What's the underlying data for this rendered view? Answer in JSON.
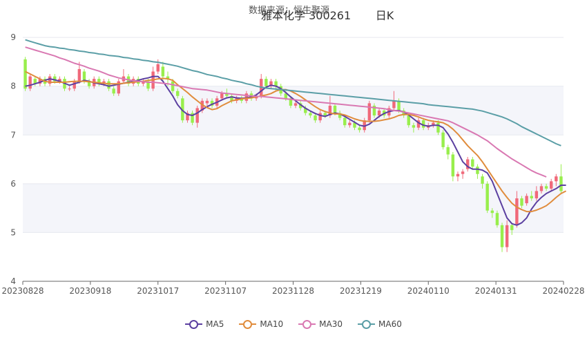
{
  "watermark": "数据来源：恒生聚源",
  "title": "雅本化学 300261       日K",
  "chart_data": {
    "type": "candlestick",
    "x_ticks": [
      "20230828",
      "20230918",
      "20231017",
      "20231107",
      "20231128",
      "20231219",
      "20240110",
      "20240131",
      "20240228"
    ],
    "y_ticks": [
      4,
      5,
      6,
      7,
      8,
      9
    ],
    "ylim": [
      4,
      9.2
    ],
    "colors": {
      "up": "#f0697a",
      "down": "#98ee4c"
    },
    "candles": [
      {
        "o": 8.55,
        "c": 7.95,
        "h": 8.6,
        "l": 7.9
      },
      {
        "o": 7.95,
        "c": 8.2,
        "h": 8.25,
        "l": 7.9
      },
      {
        "o": 8.15,
        "c": 8.05,
        "h": 8.2,
        "l": 8.0
      },
      {
        "o": 8.05,
        "c": 8.15,
        "h": 8.2,
        "l": 8.0
      },
      {
        "o": 8.15,
        "c": 8.05,
        "h": 8.2,
        "l": 8.0
      },
      {
        "o": 8.05,
        "c": 8.2,
        "h": 8.25,
        "l": 8.0
      },
      {
        "o": 8.2,
        "c": 8.1,
        "h": 8.25,
        "l": 8.05
      },
      {
        "o": 8.1,
        "c": 8.15,
        "h": 8.2,
        "l": 8.05
      },
      {
        "o": 8.15,
        "c": 7.95,
        "h": 8.2,
        "l": 7.9
      },
      {
        "o": 7.95,
        "c": 7.95,
        "h": 8.0,
        "l": 7.9
      },
      {
        "o": 7.95,
        "c": 8.1,
        "h": 8.15,
        "l": 7.9
      },
      {
        "o": 8.1,
        "c": 8.35,
        "h": 8.5,
        "l": 8.05
      },
      {
        "o": 8.3,
        "c": 8.1,
        "h": 8.35,
        "l": 8.05
      },
      {
        "o": 8.1,
        "c": 8.0,
        "h": 8.15,
        "l": 7.95
      },
      {
        "o": 8.0,
        "c": 8.15,
        "h": 8.2,
        "l": 7.95
      },
      {
        "o": 8.15,
        "c": 8.05,
        "h": 8.2,
        "l": 8.0
      },
      {
        "o": 8.05,
        "c": 8.1,
        "h": 8.15,
        "l": 8.0
      },
      {
        "o": 8.1,
        "c": 7.95,
        "h": 8.15,
        "l": 7.9
      },
      {
        "o": 7.95,
        "c": 7.85,
        "h": 8.0,
        "l": 7.8
      },
      {
        "o": 7.85,
        "c": 8.1,
        "h": 8.15,
        "l": 7.8
      },
      {
        "o": 8.1,
        "c": 8.2,
        "h": 8.35,
        "l": 8.05
      },
      {
        "o": 8.2,
        "c": 8.05,
        "h": 8.25,
        "l": 8.0
      },
      {
        "o": 8.05,
        "c": 8.15,
        "h": 8.2,
        "l": 8.0
      },
      {
        "o": 8.15,
        "c": 8.05,
        "h": 8.2,
        "l": 8.0
      },
      {
        "o": 8.05,
        "c": 8.1,
        "h": 8.15,
        "l": 8.0
      },
      {
        "o": 8.1,
        "c": 7.95,
        "h": 8.15,
        "l": 7.9
      },
      {
        "o": 7.95,
        "c": 8.3,
        "h": 8.4,
        "l": 7.9
      },
      {
        "o": 8.3,
        "c": 8.45,
        "h": 8.55,
        "l": 8.25
      },
      {
        "o": 8.4,
        "c": 8.2,
        "h": 8.5,
        "l": 8.1
      },
      {
        "o": 8.2,
        "c": 8.15,
        "h": 8.3,
        "l": 8.0
      },
      {
        "o": 8.1,
        "c": 7.9,
        "h": 8.15,
        "l": 7.85
      },
      {
        "o": 7.9,
        "c": 7.8,
        "h": 7.95,
        "l": 7.75
      },
      {
        "o": 7.75,
        "c": 7.3,
        "h": 7.8,
        "l": 7.25
      },
      {
        "o": 7.3,
        "c": 7.45,
        "h": 7.5,
        "l": 7.25
      },
      {
        "o": 7.45,
        "c": 7.25,
        "h": 7.5,
        "l": 7.2
      },
      {
        "o": 7.25,
        "c": 7.55,
        "h": 7.6,
        "l": 7.15
      },
      {
        "o": 7.5,
        "c": 7.7,
        "h": 7.75,
        "l": 7.45
      },
      {
        "o": 7.65,
        "c": 7.7,
        "h": 7.75,
        "l": 7.6
      },
      {
        "o": 7.7,
        "c": 7.6,
        "h": 7.75,
        "l": 7.55
      },
      {
        "o": 7.6,
        "c": 7.75,
        "h": 7.8,
        "l": 7.55
      },
      {
        "o": 7.75,
        "c": 7.85,
        "h": 7.9,
        "l": 7.7
      },
      {
        "o": 7.85,
        "c": 7.8,
        "h": 7.95,
        "l": 7.75
      },
      {
        "o": 7.8,
        "c": 7.7,
        "h": 7.85,
        "l": 7.65
      },
      {
        "o": 7.7,
        "c": 7.75,
        "h": 7.8,
        "l": 7.65
      },
      {
        "o": 7.75,
        "c": 7.7,
        "h": 7.8,
        "l": 7.65
      },
      {
        "o": 7.7,
        "c": 7.85,
        "h": 7.9,
        "l": 7.65
      },
      {
        "o": 7.85,
        "c": 7.75,
        "h": 7.9,
        "l": 7.7
      },
      {
        "o": 7.75,
        "c": 7.8,
        "h": 7.85,
        "l": 7.7
      },
      {
        "o": 7.8,
        "c": 8.15,
        "h": 8.25,
        "l": 7.75
      },
      {
        "o": 8.15,
        "c": 8.0,
        "h": 8.2,
        "l": 7.95
      },
      {
        "o": 8.0,
        "c": 8.1,
        "h": 8.15,
        "l": 7.95
      },
      {
        "o": 8.1,
        "c": 8.0,
        "h": 8.15,
        "l": 7.9
      },
      {
        "o": 8.0,
        "c": 7.85,
        "h": 8.05,
        "l": 7.8
      },
      {
        "o": 7.85,
        "c": 7.75,
        "h": 7.9,
        "l": 7.7
      },
      {
        "o": 7.75,
        "c": 7.6,
        "h": 7.8,
        "l": 7.55
      },
      {
        "o": 7.6,
        "c": 7.65,
        "h": 7.7,
        "l": 7.55
      },
      {
        "o": 7.65,
        "c": 7.55,
        "h": 7.7,
        "l": 7.5
      },
      {
        "o": 7.55,
        "c": 7.45,
        "h": 7.6,
        "l": 7.4
      },
      {
        "o": 7.45,
        "c": 7.4,
        "h": 7.5,
        "l": 7.35
      },
      {
        "o": 7.4,
        "c": 7.3,
        "h": 7.45,
        "l": 7.25
      },
      {
        "o": 7.3,
        "c": 7.45,
        "h": 7.5,
        "l": 7.25
      },
      {
        "o": 7.45,
        "c": 7.4,
        "h": 7.5,
        "l": 7.35
      },
      {
        "o": 7.4,
        "c": 7.6,
        "h": 7.8,
        "l": 7.35
      },
      {
        "o": 7.6,
        "c": 7.45,
        "h": 7.65,
        "l": 7.4
      },
      {
        "o": 7.45,
        "c": 7.35,
        "h": 7.5,
        "l": 7.3
      },
      {
        "o": 7.35,
        "c": 7.2,
        "h": 7.4,
        "l": 7.15
      },
      {
        "o": 7.2,
        "c": 7.25,
        "h": 7.3,
        "l": 7.15
      },
      {
        "o": 7.25,
        "c": 7.15,
        "h": 7.3,
        "l": 7.1
      },
      {
        "o": 7.15,
        "c": 7.1,
        "h": 7.2,
        "l": 7.05
      },
      {
        "o": 7.1,
        "c": 7.3,
        "h": 7.35,
        "l": 7.05
      },
      {
        "o": 7.3,
        "c": 7.65,
        "h": 7.7,
        "l": 7.25
      },
      {
        "o": 7.6,
        "c": 7.4,
        "h": 7.65,
        "l": 7.35
      },
      {
        "o": 7.4,
        "c": 7.5,
        "h": 7.55,
        "l": 7.35
      },
      {
        "o": 7.5,
        "c": 7.4,
        "h": 7.55,
        "l": 7.35
      },
      {
        "o": 7.4,
        "c": 7.55,
        "h": 7.6,
        "l": 7.35
      },
      {
        "o": 7.55,
        "c": 7.7,
        "h": 7.9,
        "l": 7.5
      },
      {
        "o": 7.7,
        "c": 7.5,
        "h": 7.75,
        "l": 7.45
      },
      {
        "o": 7.5,
        "c": 7.4,
        "h": 7.55,
        "l": 7.35
      },
      {
        "o": 7.4,
        "c": 7.2,
        "h": 7.45,
        "l": 7.15
      },
      {
        "o": 7.2,
        "c": 7.15,
        "h": 7.25,
        "l": 7.05
      },
      {
        "o": 7.15,
        "c": 7.3,
        "h": 7.35,
        "l": 7.1
      },
      {
        "o": 7.3,
        "c": 7.15,
        "h": 7.35,
        "l": 7.1
      },
      {
        "o": 7.15,
        "c": 7.2,
        "h": 7.25,
        "l": 7.1
      },
      {
        "o": 7.2,
        "c": 7.25,
        "h": 7.3,
        "l": 7.15
      },
      {
        "o": 7.25,
        "c": 7.05,
        "h": 7.3,
        "l": 7.0
      },
      {
        "o": 7.05,
        "c": 6.75,
        "h": 7.1,
        "l": 6.7
      },
      {
        "o": 6.75,
        "c": 6.6,
        "h": 6.8,
        "l": 6.5
      },
      {
        "o": 6.6,
        "c": 6.15,
        "h": 6.65,
        "l": 6.05
      },
      {
        "o": 6.15,
        "c": 6.2,
        "h": 6.25,
        "l": 6.05
      },
      {
        "o": 6.2,
        "c": 6.25,
        "h": 6.3,
        "l": 6.1
      },
      {
        "o": 6.3,
        "c": 6.5,
        "h": 6.55,
        "l": 6.25
      },
      {
        "o": 6.5,
        "c": 6.35,
        "h": 6.55,
        "l": 6.3
      },
      {
        "o": 6.35,
        "c": 6.2,
        "h": 6.4,
        "l": 6.1
      },
      {
        "o": 6.15,
        "c": 6.0,
        "h": 6.2,
        "l": 5.9
      },
      {
        "o": 6.0,
        "c": 5.45,
        "h": 6.05,
        "l": 5.4
      },
      {
        "o": 5.45,
        "c": 5.4,
        "h": 5.5,
        "l": 5.3
      },
      {
        "o": 5.4,
        "c": 5.15,
        "h": 5.45,
        "l": 5.1
      },
      {
        "o": 5.15,
        "c": 4.7,
        "h": 5.2,
        "l": 4.6
      },
      {
        "o": 4.7,
        "c": 5.15,
        "h": 5.25,
        "l": 4.6
      },
      {
        "o": 5.15,
        "c": 5.05,
        "h": 5.2,
        "l": 4.95
      },
      {
        "o": 5.15,
        "c": 5.7,
        "h": 5.85,
        "l": 5.1
      },
      {
        "o": 5.7,
        "c": 5.55,
        "h": 5.75,
        "l": 5.5
      },
      {
        "o": 5.6,
        "c": 5.75,
        "h": 5.8,
        "l": 5.55
      },
      {
        "o": 5.75,
        "c": 5.7,
        "h": 5.85,
        "l": 5.65
      },
      {
        "o": 5.7,
        "c": 5.85,
        "h": 5.95,
        "l": 5.65
      },
      {
        "o": 5.85,
        "c": 5.95,
        "h": 6.0,
        "l": 5.8
      },
      {
        "o": 5.95,
        "c": 5.9,
        "h": 6.0,
        "l": 5.85
      },
      {
        "o": 5.9,
        "c": 6.05,
        "h": 6.1,
        "l": 5.85
      },
      {
        "o": 6.05,
        "c": 6.15,
        "h": 6.2,
        "l": 5.95
      },
      {
        "o": 6.15,
        "c": 5.85,
        "h": 6.4,
        "l": 5.8
      }
    ],
    "series": [
      {
        "name": "MA5",
        "color": "#5b3fa0",
        "values": [
          8.0,
          8.02,
          8.05,
          8.08,
          8.12,
          8.15,
          8.13,
          8.1,
          8.06,
          8.02,
          8.05,
          8.08,
          8.12,
          8.1,
          8.07,
          8.05,
          8.03,
          8.0,
          8.02,
          8.04,
          8.06,
          8.08,
          8.1,
          8.12,
          8.15,
          8.17,
          8.2,
          8.2,
          8.1,
          7.95,
          7.8,
          7.62,
          7.5,
          7.42,
          7.4,
          7.45,
          7.52,
          7.58,
          7.63,
          7.67,
          7.72,
          7.76,
          7.78,
          7.76,
          7.75,
          7.76,
          7.78,
          7.82,
          7.9,
          7.98,
          8.02,
          8.0,
          7.95,
          7.87,
          7.78,
          7.7,
          7.62,
          7.55,
          7.49,
          7.44,
          7.4,
          7.38,
          7.42,
          7.45,
          7.43,
          7.38,
          7.32,
          7.26,
          7.2,
          7.18,
          7.22,
          7.3,
          7.38,
          7.44,
          7.48,
          7.5,
          7.5,
          7.47,
          7.41,
          7.33,
          7.25,
          7.2,
          7.18,
          7.2,
          7.2,
          7.15,
          7.02,
          6.85,
          6.65,
          6.45,
          6.35,
          6.3,
          6.3,
          6.28,
          6.22,
          6.05,
          5.8,
          5.55,
          5.3,
          5.18,
          5.15,
          5.2,
          5.3,
          5.48,
          5.62,
          5.72,
          5.8,
          5.85,
          5.9,
          5.97,
          5.97
        ]
      },
      {
        "name": "MA10",
        "color": "#e08c3c",
        "values": [
          8.3,
          8.25,
          8.2,
          8.15,
          8.1,
          8.08,
          8.08,
          8.08,
          8.08,
          8.09,
          8.1,
          8.1,
          8.1,
          8.09,
          8.08,
          8.07,
          8.06,
          8.05,
          8.05,
          8.05,
          8.06,
          8.07,
          8.08,
          8.09,
          8.1,
          8.12,
          8.13,
          8.15,
          8.16,
          8.15,
          8.12,
          8.03,
          7.95,
          7.87,
          7.78,
          7.7,
          7.62,
          7.56,
          7.52,
          7.54,
          7.6,
          7.65,
          7.7,
          7.72,
          7.74,
          7.75,
          7.76,
          7.78,
          7.8,
          7.82,
          7.85,
          7.9,
          7.93,
          7.93,
          7.9,
          7.85,
          7.79,
          7.72,
          7.65,
          7.58,
          7.52,
          7.48,
          7.45,
          7.43,
          7.43,
          7.41,
          7.37,
          7.33,
          7.3,
          7.28,
          7.28,
          7.28,
          7.29,
          7.31,
          7.33,
          7.36,
          7.4,
          7.42,
          7.42,
          7.4,
          7.37,
          7.33,
          7.3,
          7.28,
          7.27,
          7.25,
          7.2,
          7.12,
          7.02,
          6.9,
          6.78,
          6.68,
          6.58,
          6.45,
          6.3,
          6.15,
          6.0,
          5.85,
          5.72,
          5.6,
          5.52,
          5.47,
          5.43,
          5.43,
          5.46,
          5.5,
          5.55,
          5.63,
          5.72,
          5.8,
          5.85
        ]
      },
      {
        "name": "MA30",
        "color": "#d978b2",
        "values": [
          8.8,
          8.77,
          8.74,
          8.71,
          8.68,
          8.65,
          8.62,
          8.58,
          8.55,
          8.51,
          8.47,
          8.44,
          8.41,
          8.37,
          8.34,
          8.31,
          8.27,
          8.23,
          8.2,
          8.17,
          8.15,
          8.13,
          8.11,
          8.1,
          8.09,
          8.08,
          8.08,
          8.07,
          8.06,
          8.05,
          8.03,
          8.01,
          7.99,
          7.97,
          7.95,
          7.94,
          7.93,
          7.92,
          7.9,
          7.88,
          7.86,
          7.85,
          7.84,
          7.83,
          7.82,
          7.81,
          7.8,
          7.79,
          7.79,
          7.78,
          7.77,
          7.76,
          7.75,
          7.74,
          7.73,
          7.72,
          7.71,
          7.7,
          7.69,
          7.68,
          7.67,
          7.66,
          7.65,
          7.64,
          7.63,
          7.62,
          7.61,
          7.6,
          7.59,
          7.58,
          7.57,
          7.56,
          7.55,
          7.54,
          7.52,
          7.5,
          7.49,
          7.47,
          7.45,
          7.43,
          7.41,
          7.39,
          7.37,
          7.35,
          7.33,
          7.31,
          7.29,
          7.25,
          7.2,
          7.15,
          7.1,
          7.05,
          7.0,
          6.94,
          6.88,
          6.8,
          6.72,
          6.65,
          6.58,
          6.51,
          6.45,
          6.39,
          6.33,
          6.27,
          6.22,
          6.18,
          6.14
        ]
      },
      {
        "name": "MA60",
        "color": "#5a9ea6",
        "values": [
          8.95,
          8.92,
          8.89,
          8.86,
          8.83,
          8.81,
          8.8,
          8.78,
          8.77,
          8.75,
          8.74,
          8.72,
          8.71,
          8.69,
          8.68,
          8.66,
          8.65,
          8.63,
          8.62,
          8.61,
          8.59,
          8.58,
          8.56,
          8.55,
          8.53,
          8.52,
          8.5,
          8.49,
          8.47,
          8.45,
          8.43,
          8.41,
          8.38,
          8.35,
          8.32,
          8.3,
          8.27,
          8.24,
          8.22,
          8.2,
          8.17,
          8.15,
          8.12,
          8.1,
          8.08,
          8.05,
          8.03,
          8.0,
          7.98,
          7.96,
          7.95,
          7.94,
          7.93,
          7.92,
          7.91,
          7.9,
          7.89,
          7.88,
          7.87,
          7.86,
          7.85,
          7.84,
          7.83,
          7.82,
          7.81,
          7.8,
          7.79,
          7.78,
          7.77,
          7.76,
          7.75,
          7.74,
          7.73,
          7.72,
          7.71,
          7.7,
          7.69,
          7.68,
          7.67,
          7.66,
          7.65,
          7.64,
          7.62,
          7.61,
          7.6,
          7.59,
          7.58,
          7.57,
          7.56,
          7.55,
          7.54,
          7.53,
          7.51,
          7.49,
          7.46,
          7.43,
          7.4,
          7.37,
          7.33,
          7.28,
          7.23,
          7.17,
          7.12,
          7.07,
          7.02,
          6.97,
          6.92,
          6.87,
          6.82,
          6.78
        ]
      }
    ]
  }
}
